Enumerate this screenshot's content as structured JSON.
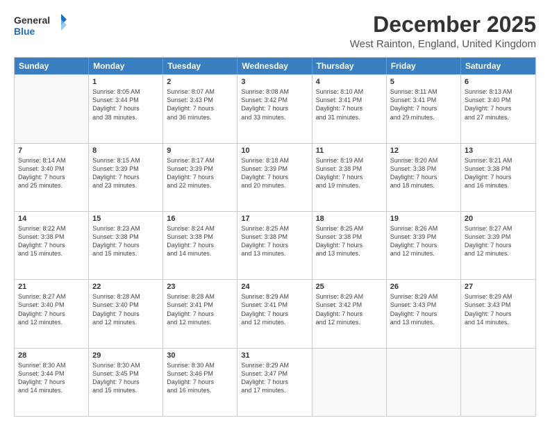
{
  "logo": {
    "general": "General",
    "blue": "Blue"
  },
  "title": "December 2025",
  "location": "West Rainton, England, United Kingdom",
  "weekdays": [
    "Sunday",
    "Monday",
    "Tuesday",
    "Wednesday",
    "Thursday",
    "Friday",
    "Saturday"
  ],
  "weeks": [
    [
      {
        "day": "",
        "content": ""
      },
      {
        "day": "1",
        "content": "Sunrise: 8:05 AM\nSunset: 3:44 PM\nDaylight: 7 hours\nand 38 minutes."
      },
      {
        "day": "2",
        "content": "Sunrise: 8:07 AM\nSunset: 3:43 PM\nDaylight: 7 hours\nand 36 minutes."
      },
      {
        "day": "3",
        "content": "Sunrise: 8:08 AM\nSunset: 3:42 PM\nDaylight: 7 hours\nand 33 minutes."
      },
      {
        "day": "4",
        "content": "Sunrise: 8:10 AM\nSunset: 3:41 PM\nDaylight: 7 hours\nand 31 minutes."
      },
      {
        "day": "5",
        "content": "Sunrise: 8:11 AM\nSunset: 3:41 PM\nDaylight: 7 hours\nand 29 minutes."
      },
      {
        "day": "6",
        "content": "Sunrise: 8:13 AM\nSunset: 3:40 PM\nDaylight: 7 hours\nand 27 minutes."
      }
    ],
    [
      {
        "day": "7",
        "content": "Sunrise: 8:14 AM\nSunset: 3:40 PM\nDaylight: 7 hours\nand 25 minutes."
      },
      {
        "day": "8",
        "content": "Sunrise: 8:15 AM\nSunset: 3:39 PM\nDaylight: 7 hours\nand 23 minutes."
      },
      {
        "day": "9",
        "content": "Sunrise: 8:17 AM\nSunset: 3:39 PM\nDaylight: 7 hours\nand 22 minutes."
      },
      {
        "day": "10",
        "content": "Sunrise: 8:18 AM\nSunset: 3:39 PM\nDaylight: 7 hours\nand 20 minutes."
      },
      {
        "day": "11",
        "content": "Sunrise: 8:19 AM\nSunset: 3:38 PM\nDaylight: 7 hours\nand 19 minutes."
      },
      {
        "day": "12",
        "content": "Sunrise: 8:20 AM\nSunset: 3:38 PM\nDaylight: 7 hours\nand 18 minutes."
      },
      {
        "day": "13",
        "content": "Sunrise: 8:21 AM\nSunset: 3:38 PM\nDaylight: 7 hours\nand 16 minutes."
      }
    ],
    [
      {
        "day": "14",
        "content": "Sunrise: 8:22 AM\nSunset: 3:38 PM\nDaylight: 7 hours\nand 15 minutes."
      },
      {
        "day": "15",
        "content": "Sunrise: 8:23 AM\nSunset: 3:38 PM\nDaylight: 7 hours\nand 15 minutes."
      },
      {
        "day": "16",
        "content": "Sunrise: 8:24 AM\nSunset: 3:38 PM\nDaylight: 7 hours\nand 14 minutes."
      },
      {
        "day": "17",
        "content": "Sunrise: 8:25 AM\nSunset: 3:38 PM\nDaylight: 7 hours\nand 13 minutes."
      },
      {
        "day": "18",
        "content": "Sunrise: 8:25 AM\nSunset: 3:38 PM\nDaylight: 7 hours\nand 13 minutes."
      },
      {
        "day": "19",
        "content": "Sunrise: 8:26 AM\nSunset: 3:39 PM\nDaylight: 7 hours\nand 12 minutes."
      },
      {
        "day": "20",
        "content": "Sunrise: 8:27 AM\nSunset: 3:39 PM\nDaylight: 7 hours\nand 12 minutes."
      }
    ],
    [
      {
        "day": "21",
        "content": "Sunrise: 8:27 AM\nSunset: 3:40 PM\nDaylight: 7 hours\nand 12 minutes."
      },
      {
        "day": "22",
        "content": "Sunrise: 8:28 AM\nSunset: 3:40 PM\nDaylight: 7 hours\nand 12 minutes."
      },
      {
        "day": "23",
        "content": "Sunrise: 8:28 AM\nSunset: 3:41 PM\nDaylight: 7 hours\nand 12 minutes."
      },
      {
        "day": "24",
        "content": "Sunrise: 8:29 AM\nSunset: 3:41 PM\nDaylight: 7 hours\nand 12 minutes."
      },
      {
        "day": "25",
        "content": "Sunrise: 8:29 AM\nSunset: 3:42 PM\nDaylight: 7 hours\nand 12 minutes."
      },
      {
        "day": "26",
        "content": "Sunrise: 8:29 AM\nSunset: 3:43 PM\nDaylight: 7 hours\nand 13 minutes."
      },
      {
        "day": "27",
        "content": "Sunrise: 8:29 AM\nSunset: 3:43 PM\nDaylight: 7 hours\nand 14 minutes."
      }
    ],
    [
      {
        "day": "28",
        "content": "Sunrise: 8:30 AM\nSunset: 3:44 PM\nDaylight: 7 hours\nand 14 minutes."
      },
      {
        "day": "29",
        "content": "Sunrise: 8:30 AM\nSunset: 3:45 PM\nDaylight: 7 hours\nand 15 minutes."
      },
      {
        "day": "30",
        "content": "Sunrise: 8:30 AM\nSunset: 3:46 PM\nDaylight: 7 hours\nand 16 minutes."
      },
      {
        "day": "31",
        "content": "Sunrise: 8:29 AM\nSunset: 3:47 PM\nDaylight: 7 hours\nand 17 minutes."
      },
      {
        "day": "",
        "content": ""
      },
      {
        "day": "",
        "content": ""
      },
      {
        "day": "",
        "content": ""
      }
    ]
  ]
}
